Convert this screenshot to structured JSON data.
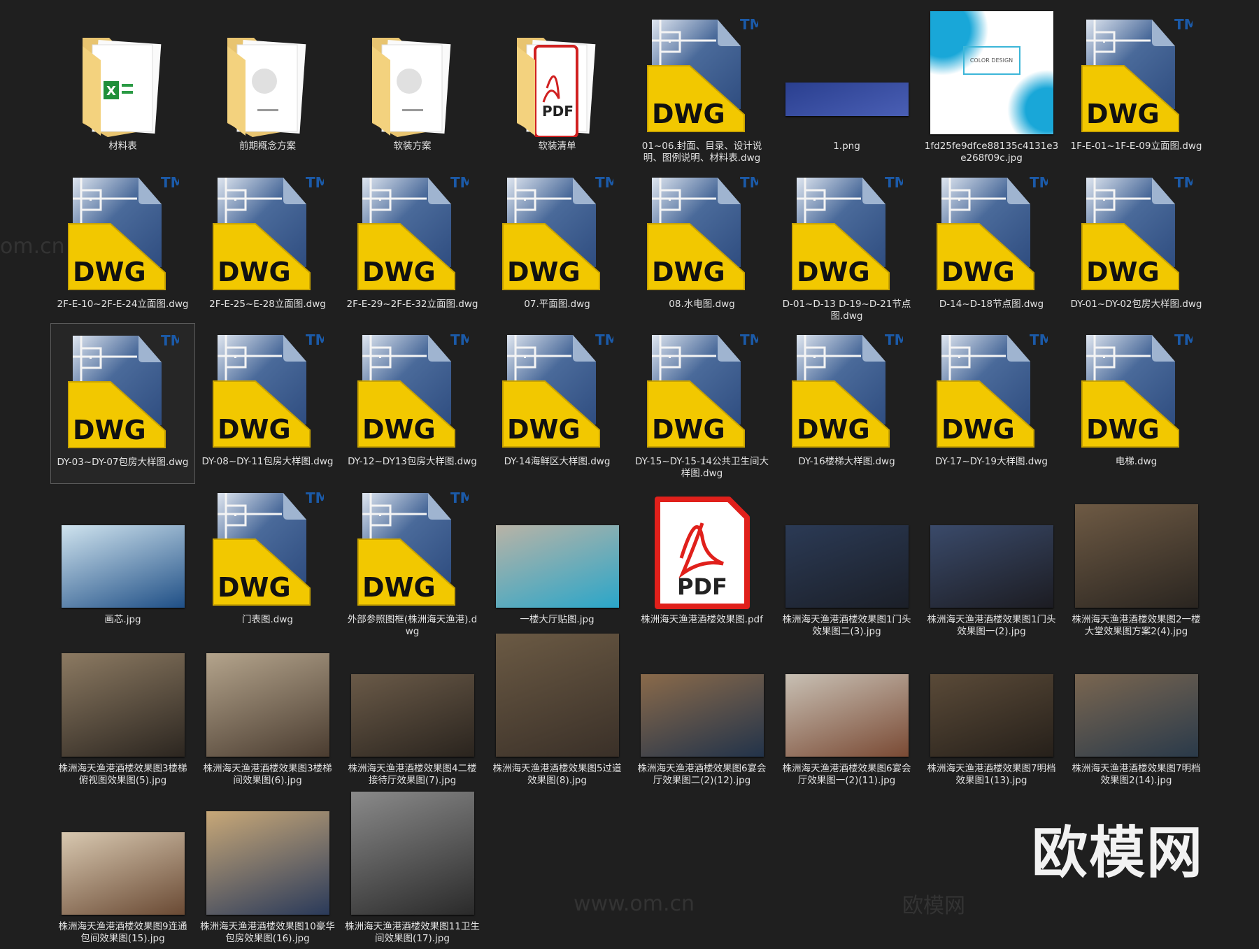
{
  "colors": {
    "background": "#1f1f1f",
    "label": "#e2e2e2",
    "dwg_yellow": "#f2c800",
    "dwg_blue": "#2f4d80",
    "pdf_red": "#e0201b"
  },
  "watermark": {
    "logo": "欧模网",
    "site": "www.om.cn"
  },
  "rows": [
    [
      {
        "label": "材料表",
        "kind": "folder",
        "doc": "excel"
      },
      {
        "label": "前期概念方案",
        "kind": "folder",
        "doc": "paper"
      },
      {
        "label": "软装方案",
        "kind": "folder",
        "doc": "paper"
      },
      {
        "label": "软装清单",
        "kind": "folder",
        "doc": "pdf"
      },
      {
        "label": "01~06.封面、目录、设计说明、图例说明、材料表.dwg",
        "kind": "dwg"
      },
      {
        "label": "1.png",
        "kind": "image",
        "shape": "wide",
        "c1": "#2a3f8f",
        "c2": "#4a5fb5"
      },
      {
        "label": "1fd25fe9dfce88135c4131e3e268f09c.jpg",
        "kind": "image",
        "shape": "square",
        "c1": "#ffffff",
        "c2": "#19a7d8",
        "caption": "COLOR DESIGN"
      },
      {
        "label": "1F-E-01~1F-E-09立面图.dwg",
        "kind": "dwg"
      }
    ],
    [
      {
        "label": "2F-E-10~2F-E-24立面图.dwg",
        "kind": "dwg"
      },
      {
        "label": "2F-E-25~E-28立面图.dwg",
        "kind": "dwg"
      },
      {
        "label": "2F-E-29~2F-E-32立面图.dwg",
        "kind": "dwg"
      },
      {
        "label": "07.平面图.dwg",
        "kind": "dwg"
      },
      {
        "label": "08.水电图.dwg",
        "kind": "dwg"
      },
      {
        "label": "D-01~D-13 D-19~D-21节点图.dwg",
        "kind": "dwg"
      },
      {
        "label": "D-14~D-18节点图.dwg",
        "kind": "dwg"
      },
      {
        "label": "DY-01~DY-02包房大样图.dwg",
        "kind": "dwg"
      }
    ],
    [
      {
        "label": "DY-03~DY-07包房大样图.dwg",
        "kind": "dwg",
        "selected": true
      },
      {
        "label": "DY-08~DY-11包房大样图.dwg",
        "kind": "dwg"
      },
      {
        "label": "DY-12~DY13包房大样图.dwg",
        "kind": "dwg"
      },
      {
        "label": "DY-14海鲜区大样图.dwg",
        "kind": "dwg"
      },
      {
        "label": "DY-15~DY-15-14公共卫生间大样图.dwg",
        "kind": "dwg"
      },
      {
        "label": "DY-16楼梯大样图.dwg",
        "kind": "dwg"
      },
      {
        "label": "DY-17~DY-19大样图.dwg",
        "kind": "dwg"
      },
      {
        "label": "电梯.dwg",
        "kind": "dwg"
      }
    ],
    [
      {
        "label": "画芯.jpg",
        "kind": "image",
        "shape": "landscape",
        "c1": "#cfe3ee",
        "c2": "#1f4f86"
      },
      {
        "label": "门表图.dwg",
        "kind": "dwg"
      },
      {
        "label": "外部参照图框(株洲海天渔港).dwg",
        "kind": "dwg"
      },
      {
        "label": "一楼大厅贴图.jpg",
        "kind": "image",
        "shape": "landscape",
        "c1": "#b9b3a6",
        "c2": "#2aa6c9"
      },
      {
        "label": "株洲海天渔港酒楼效果图.pdf",
        "kind": "pdf",
        "caption": "PDF"
      },
      {
        "label": "株洲海天渔港酒楼效果图1门头效果图二(3).jpg",
        "kind": "image",
        "shape": "landscape",
        "c1": "#2b3a55",
        "c2": "#1b1f28"
      },
      {
        "label": "株洲海天渔港酒楼效果图1门头效果图一(2).jpg",
        "kind": "image",
        "shape": "landscape",
        "c1": "#3a4a6a",
        "c2": "#1c1c22"
      },
      {
        "label": "株洲海天渔港酒楼效果图2一楼大堂效果图方案2(4).jpg",
        "kind": "image",
        "shape": "land2",
        "c1": "#6e5a44",
        "c2": "#2a2520"
      }
    ],
    [
      {
        "label": "株洲海天渔港酒楼效果图3楼梯俯视图效果图(5).jpg",
        "kind": "image",
        "shape": "land2",
        "c1": "#8c7a62",
        "c2": "#2c2620"
      },
      {
        "label": "株洲海天渔港酒楼效果图3楼梯间效果图(6).jpg",
        "kind": "image",
        "shape": "land2",
        "c1": "#b4a48c",
        "c2": "#4a3c30"
      },
      {
        "label": "株洲海天渔港酒楼效果图4二楼接待厅效果图(7).jpg",
        "kind": "image",
        "shape": "landscape",
        "c1": "#6a5a48",
        "c2": "#2a241e"
      },
      {
        "label": "株洲海天渔港酒楼效果图5过道效果图(8).jpg",
        "kind": "image",
        "shape": "square",
        "c1": "#6b5a44",
        "c2": "#3a3028"
      },
      {
        "label": "株洲海天渔港酒楼效果图6宴会厅效果图二(2)(12).jpg",
        "kind": "image",
        "shape": "landscape",
        "c1": "#8a6a4a",
        "c2": "#22334a"
      },
      {
        "label": "株洲海天渔港酒楼效果图6宴会厅效果图一(2)(11).jpg",
        "kind": "image",
        "shape": "landscape",
        "c1": "#c8c0b4",
        "c2": "#7a4a34"
      },
      {
        "label": "株洲海天渔港酒楼效果图7明档效果图1(13).jpg",
        "kind": "image",
        "shape": "landscape",
        "c1": "#5a4a38",
        "c2": "#26201a"
      },
      {
        "label": "株洲海天渔港酒楼效果图7明档效果图2(14).jpg",
        "kind": "image",
        "shape": "landscape",
        "c1": "#7a6650",
        "c2": "#2a3a4a"
      }
    ],
    [
      {
        "label": "株洲海天渔港酒楼效果图9连通包间效果图(15).jpg",
        "kind": "image",
        "shape": "landscape",
        "c1": "#d8c8b0",
        "c2": "#6a4a34"
      },
      {
        "label": "株洲海天渔港酒楼效果图10豪华包房效果图(16).jpg",
        "kind": "image",
        "shape": "land2",
        "c1": "#c8a878",
        "c2": "#2a3a5a"
      },
      {
        "label": "株洲海天渔港酒楼效果图11卫生间效果图(17).jpg",
        "kind": "image",
        "shape": "square",
        "c1": "#8a8a8a",
        "c2": "#2a2a2a"
      }
    ]
  ]
}
